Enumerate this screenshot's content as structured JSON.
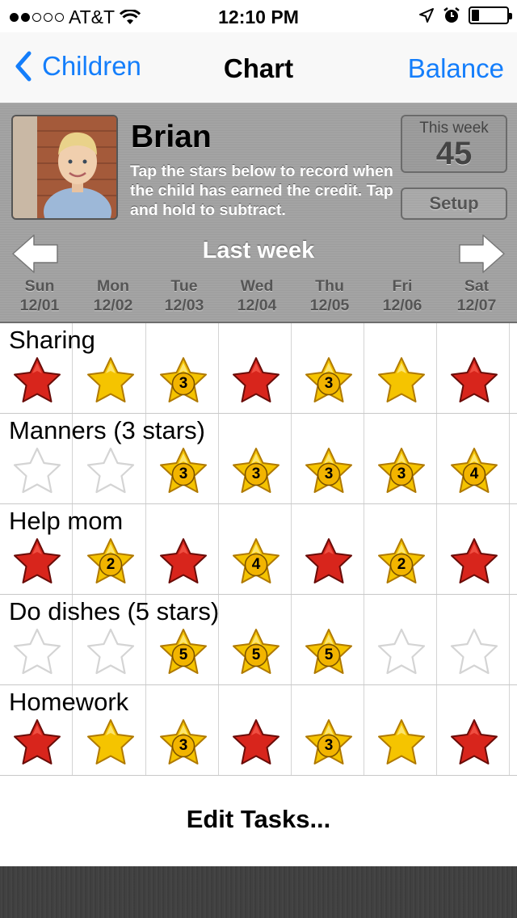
{
  "status_bar": {
    "signal_dots": [
      true,
      true,
      false,
      false,
      false
    ],
    "carrier": "AT&T",
    "time": "12:10 PM",
    "icons": [
      "wifi-icon",
      "location-arrow-icon",
      "alarm-clock-icon",
      "battery-icon"
    ],
    "battery_level": 0.2
  },
  "nav": {
    "back_label": "Children",
    "title": "Chart",
    "right_label": "Balance"
  },
  "child": {
    "name": "Brian",
    "instructions": "Tap the stars below to record when the child has earned the credit. Tap and hold to subtract.",
    "this_week_label": "This week",
    "this_week_value": "45",
    "setup_label": "Setup"
  },
  "week": {
    "label": "Last week",
    "days": [
      {
        "name": "Sun",
        "date": "12/01"
      },
      {
        "name": "Mon",
        "date": "12/02"
      },
      {
        "name": "Tue",
        "date": "12/03"
      },
      {
        "name": "Wed",
        "date": "12/04"
      },
      {
        "name": "Thu",
        "date": "12/05"
      },
      {
        "name": "Fri",
        "date": "12/06"
      },
      {
        "name": "Sat",
        "date": "12/07"
      }
    ]
  },
  "colors": {
    "accent": "#147efb",
    "red_star": "#d8251c",
    "gold_star": "#f5c400"
  },
  "tasks": [
    {
      "name": "Sharing",
      "cells": [
        {
          "kind": "red",
          "count": ""
        },
        {
          "kind": "gold",
          "count": ""
        },
        {
          "kind": "badge",
          "count": "3"
        },
        {
          "kind": "red",
          "count": ""
        },
        {
          "kind": "badge",
          "count": "3"
        },
        {
          "kind": "gold",
          "count": ""
        },
        {
          "kind": "red",
          "count": ""
        }
      ]
    },
    {
      "name": "Manners (3 stars)",
      "cells": [
        {
          "kind": "empty",
          "count": ""
        },
        {
          "kind": "empty",
          "count": ""
        },
        {
          "kind": "badge",
          "count": "3"
        },
        {
          "kind": "badge",
          "count": "3"
        },
        {
          "kind": "badge",
          "count": "3"
        },
        {
          "kind": "badge",
          "count": "3"
        },
        {
          "kind": "badge",
          "count": "4"
        }
      ]
    },
    {
      "name": "Help mom",
      "cells": [
        {
          "kind": "red",
          "count": ""
        },
        {
          "kind": "badge",
          "count": "2"
        },
        {
          "kind": "red",
          "count": ""
        },
        {
          "kind": "badge",
          "count": "4"
        },
        {
          "kind": "red",
          "count": ""
        },
        {
          "kind": "badge",
          "count": "2"
        },
        {
          "kind": "red",
          "count": ""
        }
      ]
    },
    {
      "name": "Do dishes (5 stars)",
      "cells": [
        {
          "kind": "empty",
          "count": ""
        },
        {
          "kind": "empty",
          "count": ""
        },
        {
          "kind": "badge",
          "count": "5"
        },
        {
          "kind": "badge",
          "count": "5"
        },
        {
          "kind": "badge",
          "count": "5"
        },
        {
          "kind": "empty",
          "count": ""
        },
        {
          "kind": "empty",
          "count": ""
        }
      ]
    },
    {
      "name": "Homework",
      "cells": [
        {
          "kind": "red",
          "count": ""
        },
        {
          "kind": "gold",
          "count": ""
        },
        {
          "kind": "badge",
          "count": "3"
        },
        {
          "kind": "red",
          "count": ""
        },
        {
          "kind": "badge",
          "count": "3"
        },
        {
          "kind": "gold",
          "count": ""
        },
        {
          "kind": "red",
          "count": ""
        }
      ]
    }
  ],
  "edit_tasks_label": "Edit Tasks..."
}
